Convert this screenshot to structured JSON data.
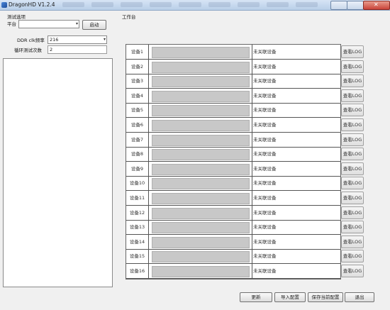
{
  "window": {
    "title": "DragonHD V1.2.4"
  },
  "left_panel": {
    "section_title": "测试选项",
    "platform_label": "平台",
    "platform_value": "",
    "start_button": "启动",
    "ddr_label": "DDR clk频率",
    "ddr_value": "216",
    "loop_label": "循环测试次数",
    "loop_value": "2"
  },
  "workbench": {
    "title": "工作台",
    "rows": [
      {
        "name": "设备1",
        "status": "未关联设备",
        "log": "查看LOG"
      },
      {
        "name": "设备2",
        "status": "未关联设备",
        "log": "查看LOG"
      },
      {
        "name": "设备3",
        "status": "未关联设备",
        "log": "查看LOG"
      },
      {
        "name": "设备4",
        "status": "未关联设备",
        "log": "查看LOG"
      },
      {
        "name": "设备5",
        "status": "未关联设备",
        "log": "查看LOG"
      },
      {
        "name": "设备6",
        "status": "未关联设备",
        "log": "查看LOG"
      },
      {
        "name": "设备7",
        "status": "未关联设备",
        "log": "查看LOG"
      },
      {
        "name": "设备8",
        "status": "未关联设备",
        "log": "查看LOG"
      },
      {
        "name": "设备9",
        "status": "未关联设备",
        "log": "查看LOG"
      },
      {
        "name": "设备10",
        "status": "未关联设备",
        "log": "查看LOG"
      },
      {
        "name": "设备11",
        "status": "未关联设备",
        "log": "查看LOG"
      },
      {
        "name": "设备12",
        "status": "未关联设备",
        "log": "查看LOG"
      },
      {
        "name": "设备13",
        "status": "未关联设备",
        "log": "查看LOG"
      },
      {
        "name": "设备14",
        "status": "未关联设备",
        "log": "查看LOG"
      },
      {
        "name": "设备15",
        "status": "未关联设备",
        "log": "查看LOG"
      },
      {
        "name": "设备16",
        "status": "未关联设备",
        "log": "查看LOG"
      }
    ]
  },
  "footer": {
    "update": "更新",
    "import": "导入配置",
    "save": "保存当前配置",
    "exit": "退出"
  }
}
